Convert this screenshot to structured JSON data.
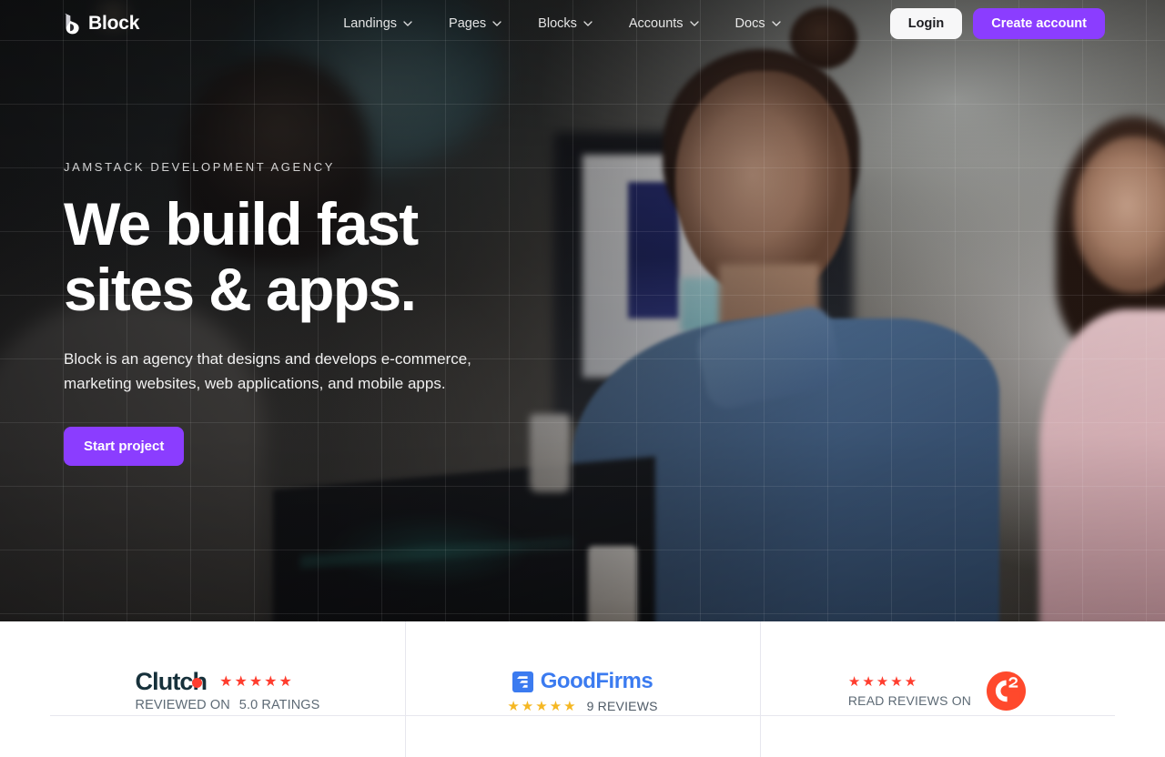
{
  "brand": {
    "name": "Block",
    "logo_icon": "block-logo-mark"
  },
  "nav": {
    "items": [
      {
        "label": "Landings",
        "icon": "chevron-down-icon"
      },
      {
        "label": "Pages",
        "icon": "chevron-down-icon"
      },
      {
        "label": "Blocks",
        "icon": "chevron-down-icon"
      },
      {
        "label": "Accounts",
        "icon": "chevron-down-icon"
      },
      {
        "label": "Docs",
        "icon": "chevron-down-icon"
      }
    ],
    "login_label": "Login",
    "create_account_label": "Create account"
  },
  "hero": {
    "eyebrow": "JAMSTACK DEVELOPMENT AGENCY",
    "title_line1": "We build fast",
    "title_line2": "sites & apps.",
    "subtitle": "Block is an agency that designs and develops e-commerce, marketing websites, web applications, and mobile apps.",
    "cta_label": "Start project"
  },
  "reviews": {
    "clutch": {
      "logo_text": "Clutch",
      "label": "REVIEWED ON",
      "rating_text": "5.0 RATINGS",
      "stars": 5,
      "star_color": "#ff3d2e"
    },
    "goodfirms": {
      "logo_text": "GoodFirms",
      "reviews_text": "9 REVIEWS",
      "stars": 5,
      "star_color": "#f5b722",
      "brand_color": "#3b7bf0"
    },
    "g2": {
      "logo_text": "G2",
      "label": "READ REVIEWS ON",
      "stars": 5,
      "star_color": "#ff492c"
    }
  },
  "colors": {
    "accent": "#8b3dff",
    "login_bg": "#f7f7f8",
    "divider": "#e7e7ee",
    "clutch_dark": "#17313b",
    "muted_text": "#5d6a75"
  }
}
